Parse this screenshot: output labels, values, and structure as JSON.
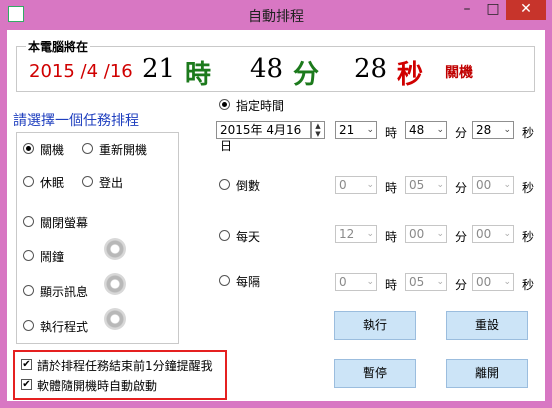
{
  "window": {
    "title": "自動排程",
    "minimize": "–",
    "maximize": "□",
    "close": "✕"
  },
  "clock": {
    "label": "本電腦將在",
    "date": "2015 /4 /16",
    "hour": "21",
    "hour_unit": "時",
    "minute": "48",
    "minute_unit": "分",
    "second": "28",
    "second_unit": "秒",
    "action": "關機"
  },
  "tasks": {
    "title": "請選擇一個任務排程",
    "options": [
      "關機",
      "重新開機",
      "休眠",
      "登出",
      "關閉螢幕",
      "鬧鐘",
      "顯示訊息",
      "執行程式"
    ],
    "selected": "關機"
  },
  "schedule": {
    "specific": {
      "label": "指定時間",
      "date": "2015年  4月16日",
      "hour": "21",
      "minute": "48",
      "second": "28"
    },
    "countdown": {
      "label": "倒數",
      "hour": "0",
      "minute": "05",
      "second": "00"
    },
    "daily": {
      "label": "每天",
      "hour": "12",
      "minute": "00",
      "second": "00"
    },
    "interval": {
      "label": "每隔",
      "hour": "0",
      "minute": "05",
      "second": "00"
    },
    "unit_hour": "時",
    "unit_minute": "分",
    "unit_second": "秒"
  },
  "options": {
    "remind": "請於排程任務結束前1分鐘提醒我",
    "autostart": "軟體隨開機時自動啟動"
  },
  "buttons": {
    "run": "執行",
    "reset": "重設",
    "pause": "暫停",
    "exit": "離開"
  },
  "colors": {
    "frame": "#d877c3",
    "date": "#d00000",
    "unit": "#1c7a1c",
    "button": "#cce4f7",
    "highlight": "#e52020"
  }
}
